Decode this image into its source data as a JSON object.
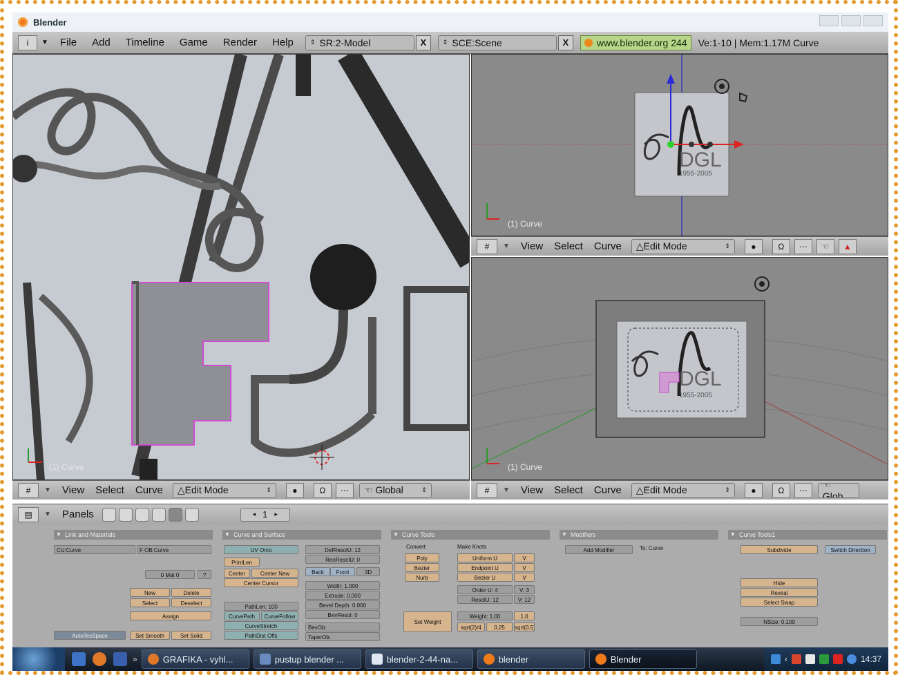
{
  "window": {
    "title": "Blender"
  },
  "top_menu": {
    "info_icon": "i",
    "items": [
      "File",
      "Add",
      "Timeline",
      "Game",
      "Render",
      "Help"
    ],
    "screen_field": "SR:2-Model",
    "scene_field": "SCE:Scene",
    "close_label": "X",
    "url": "www.blender.org 244",
    "stats": "Ve:1-10 | Mem:1.17M Curve"
  },
  "viewports": {
    "left": {
      "label": "(1) Curve"
    },
    "top_right": {
      "label": "(1) Curve"
    },
    "bottom_right": {
      "label": "(1) Curve"
    }
  },
  "viewport_header": {
    "items": [
      "View",
      "Select",
      "Curve"
    ],
    "mode": "Edit Mode",
    "orientation": "Global",
    "orientation_short": "Glob"
  },
  "buttons_window": {
    "panels_label": "Panels",
    "frame": "1",
    "panels": {
      "links": {
        "title": "Link and Materials",
        "cu_name": "CU:Curve",
        "ob_name": "F OB:Curve",
        "mat_count": "0 Mat 0",
        "q": "?",
        "new": "New",
        "delete": "Delete",
        "select": "Select",
        "deselect": "Deselect",
        "assign": "Assign",
        "autotex": "AutoTexSpace",
        "smooth": "Set Smooth",
        "solid": "Set Solid"
      },
      "curve": {
        "title": "Curve and Surface",
        "uv_orco": "UV Orco",
        "print_len": "PrintLen",
        "center": "Center",
        "center_new": "Center New",
        "center_cursor": "Center Cursor",
        "def_res": "DefResolU: 12",
        "ren_res": "RenResolU: 0",
        "back": "Back",
        "front": "Front",
        "3d": "3D",
        "width": "Width: 1.000",
        "extrude": "Extrude: 0.000",
        "bevel_depth": "Bevel Depth: 0.000",
        "bev_res": "BevResol: 0",
        "bev_ob": "BevOb:",
        "taper_ob": "TaperOb:",
        "path_len": "PathLen: 100",
        "curve_path": "CurvePath",
        "curve_follow": "CurveFollow",
        "curve_stretch": "CurveStretch",
        "path_dist": "PathDist Offs"
      },
      "tools": {
        "title": "Curve Tools",
        "convert": "Convert",
        "make_knots": "Make Knots",
        "poly": "Poly",
        "bezier": "Bezier",
        "nurb": "Nurb",
        "uniform_u": "Uniform U",
        "v": "V",
        "endpoint_u": "Endpoint U",
        "bezier_u": "Bezier U",
        "order_u": "Order U: 4",
        "v3": "V: 3",
        "resol_u": "ResolU: 12",
        "v12": "V: 12",
        "set_weight": "Set Weight",
        "weight": "Weight: 1.00",
        "one": "1.0",
        "sqrt2": "sqrt(2)/4",
        "w025": "0.25",
        "sqrt05": "sqrt(0.5)"
      },
      "modifiers": {
        "title": "Modifiers",
        "add": "Add Modifier",
        "to": "To: Curve"
      },
      "tools1": {
        "title": "Curve Tools1",
        "subdivide": "Subdivide",
        "switch": "Switch Direction",
        "hide": "Hide",
        "reveal": "Reveal",
        "select_swap": "Select Swap",
        "nsize": "NSize: 0.100"
      }
    }
  },
  "taskbar": {
    "tasks": [
      "GRAFIKA - vyhl...",
      "pustup blender ...",
      "blender-2-44-na...",
      "blender",
      "Blender"
    ],
    "clock": "14:37"
  }
}
